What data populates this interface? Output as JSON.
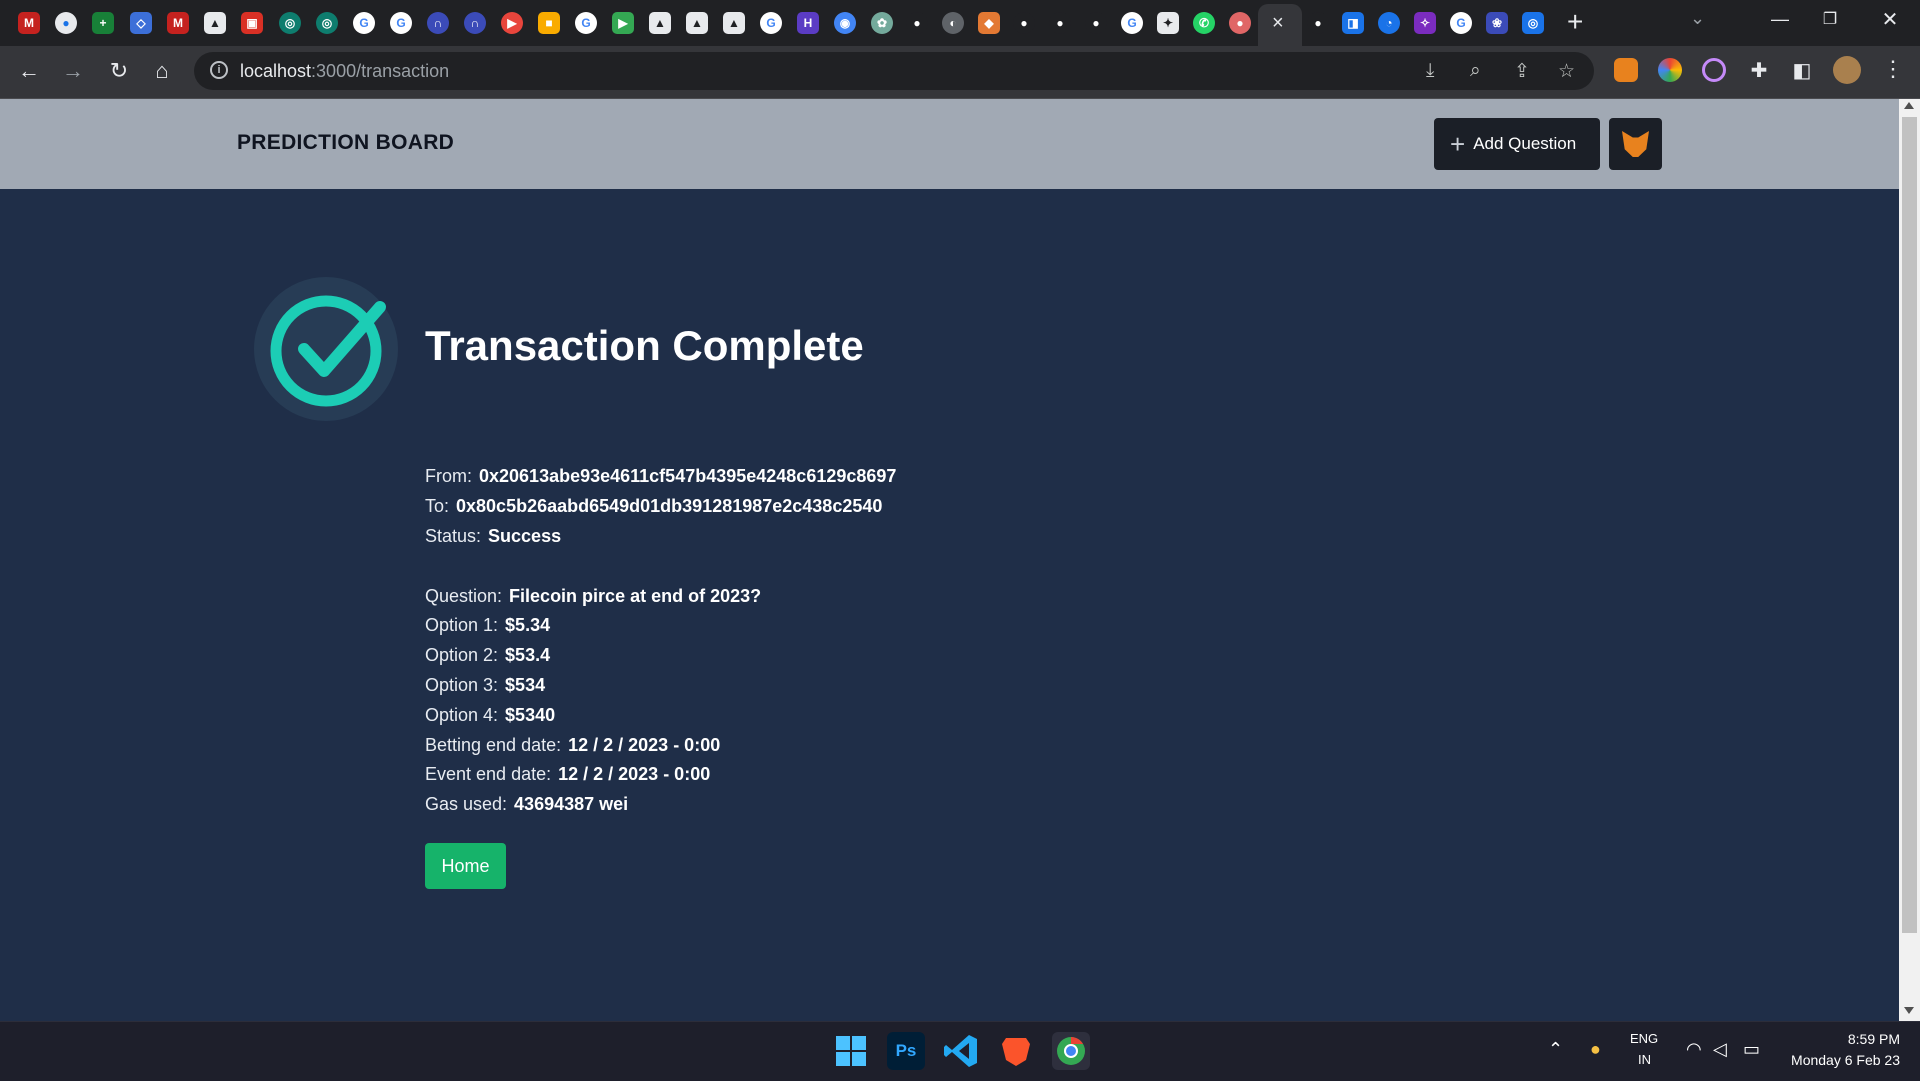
{
  "browser": {
    "url_host": "localhost",
    "url_path": ":3000/transaction",
    "active_tab_close": "×",
    "new_tab": "+"
  },
  "header": {
    "brand": "PREDICTION BOARD",
    "add_question_label": "Add Question",
    "add_question_icon": "plus-icon",
    "wallet_icon": "metamask-fox-icon"
  },
  "main": {
    "title": "Transaction Complete",
    "status_icon": "check-circle-icon",
    "details": [
      {
        "label": "From:",
        "value": "0x20613abe93e4611cf547b4395e4248c6129c8697"
      },
      {
        "label": "To:",
        "value": "0x80c5b26aabd6549d01db391281987e2c438c2540"
      },
      {
        "label": "Status:",
        "value": "Success"
      }
    ],
    "question": [
      {
        "label": "Question:",
        "value": "Filecoin pirce at end of 2023?"
      },
      {
        "label": "Option 1:",
        "value": "$5.34"
      },
      {
        "label": "Option 2:",
        "value": "$53.4"
      },
      {
        "label": "Option 3:",
        "value": "$534"
      },
      {
        "label": "Option 4:",
        "value": "$5340"
      },
      {
        "label": "Betting end date:",
        "value": "12 / 2 / 2023 - 0:00"
      },
      {
        "label": "Event end date:",
        "value": "12 / 2 / 2023 - 0:00"
      },
      {
        "label": "Gas used:",
        "value": "43694387 wei"
      }
    ],
    "home_label": "Home"
  },
  "taskbar": {
    "lang_line1": "ENG",
    "lang_line2": "IN",
    "time": "8:59 PM",
    "date": "Monday 6 Feb 23"
  },
  "colors": {
    "page_bg": "#1f2e48",
    "header_bg": "#a1a9b4",
    "accent_check": "#1ccdb5",
    "home_button": "#16b36a"
  }
}
